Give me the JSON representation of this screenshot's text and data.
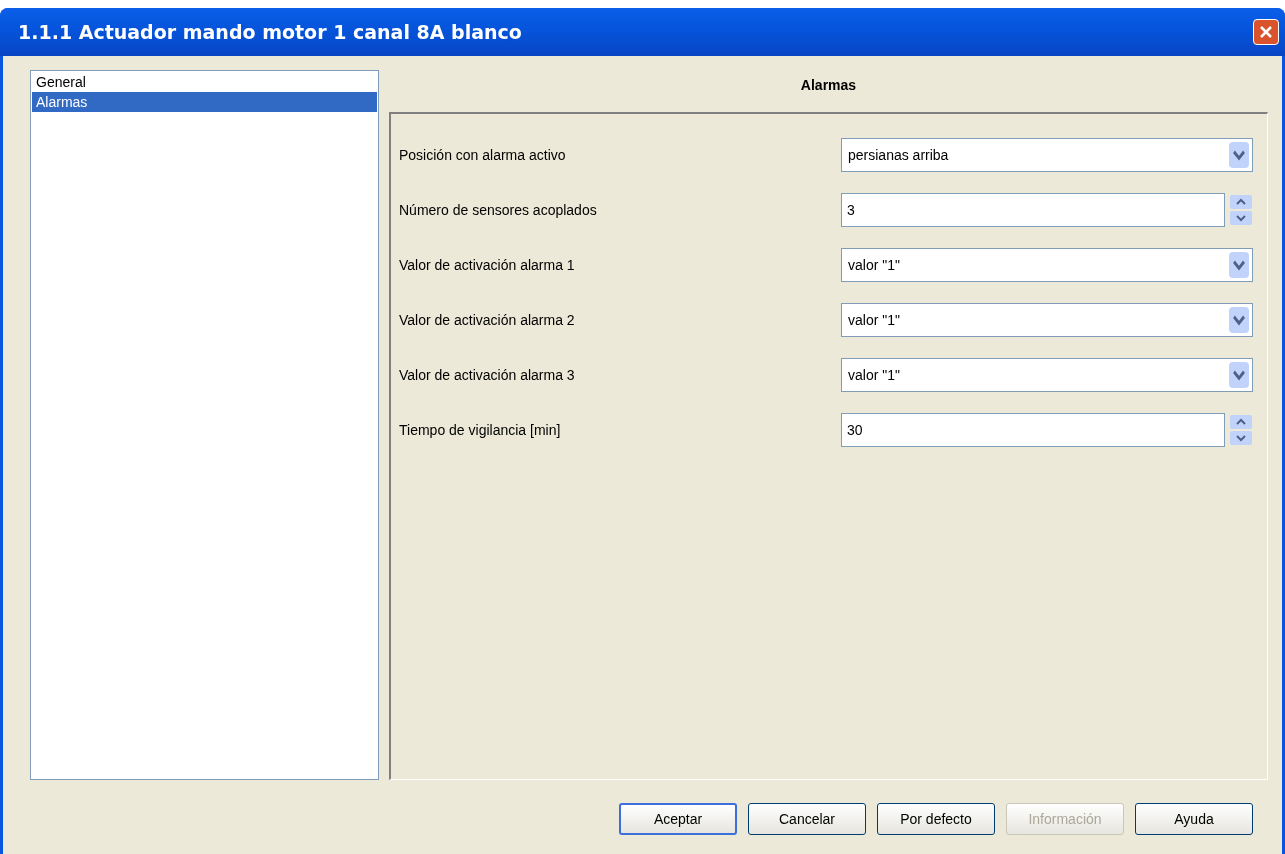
{
  "window": {
    "title": "1.1.1 Actuador mando motor 1 canal 8A blanco"
  },
  "sidebar": {
    "items": [
      {
        "label": "General",
        "selected": false
      },
      {
        "label": "Alarmas",
        "selected": true
      }
    ]
  },
  "panel": {
    "title": "Alarmas",
    "params": [
      {
        "kind": "dropdown",
        "label": "Posición con alarma activo",
        "value": "persianas arriba"
      },
      {
        "kind": "spin",
        "label": "Número de sensores acoplados",
        "value": "3"
      },
      {
        "kind": "dropdown",
        "label": "Valor de activación alarma 1",
        "value": "valor \"1\""
      },
      {
        "kind": "dropdown",
        "label": "Valor de activación alarma 2",
        "value": "valor \"1\""
      },
      {
        "kind": "dropdown",
        "label": "Valor de activación alarma 3",
        "value": "valor \"1\""
      },
      {
        "kind": "spin",
        "label": "Tiempo de vigilancia [min]",
        "value": "30"
      }
    ]
  },
  "buttons": [
    {
      "label": "Aceptar",
      "disabled": false,
      "default": true
    },
    {
      "label": "Cancelar",
      "disabled": false,
      "default": false
    },
    {
      "label": "Por defecto",
      "disabled": false,
      "default": false
    },
    {
      "label": "Información",
      "disabled": true,
      "default": false
    },
    {
      "label": "Ayuda",
      "disabled": false,
      "default": false
    }
  ]
}
